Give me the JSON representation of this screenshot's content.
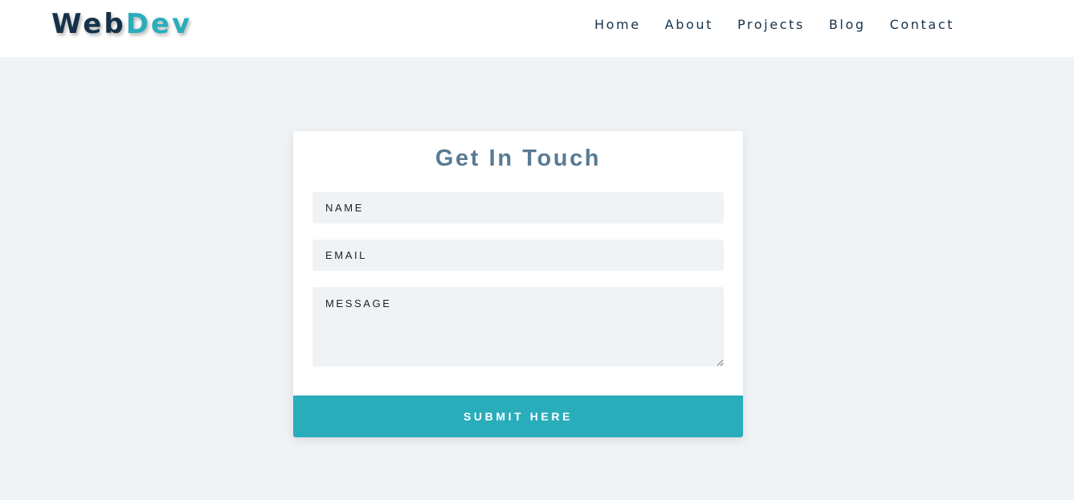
{
  "logo": {
    "part1": "Web",
    "part2": "Dev"
  },
  "nav": {
    "home": "Home",
    "about": "About",
    "projects": "Projects",
    "blog": "Blog",
    "contact": "Contact"
  },
  "form": {
    "title": "Get In Touch",
    "name_placeholder": "NAME",
    "email_placeholder": "EMAIL",
    "message_placeholder": "MESSAGE",
    "submit_label": "SUBMIT HERE"
  },
  "colors": {
    "navy": "#16324a",
    "teal": "#2aadbb",
    "page_background": "#eff3f6",
    "title": "#587b94"
  }
}
